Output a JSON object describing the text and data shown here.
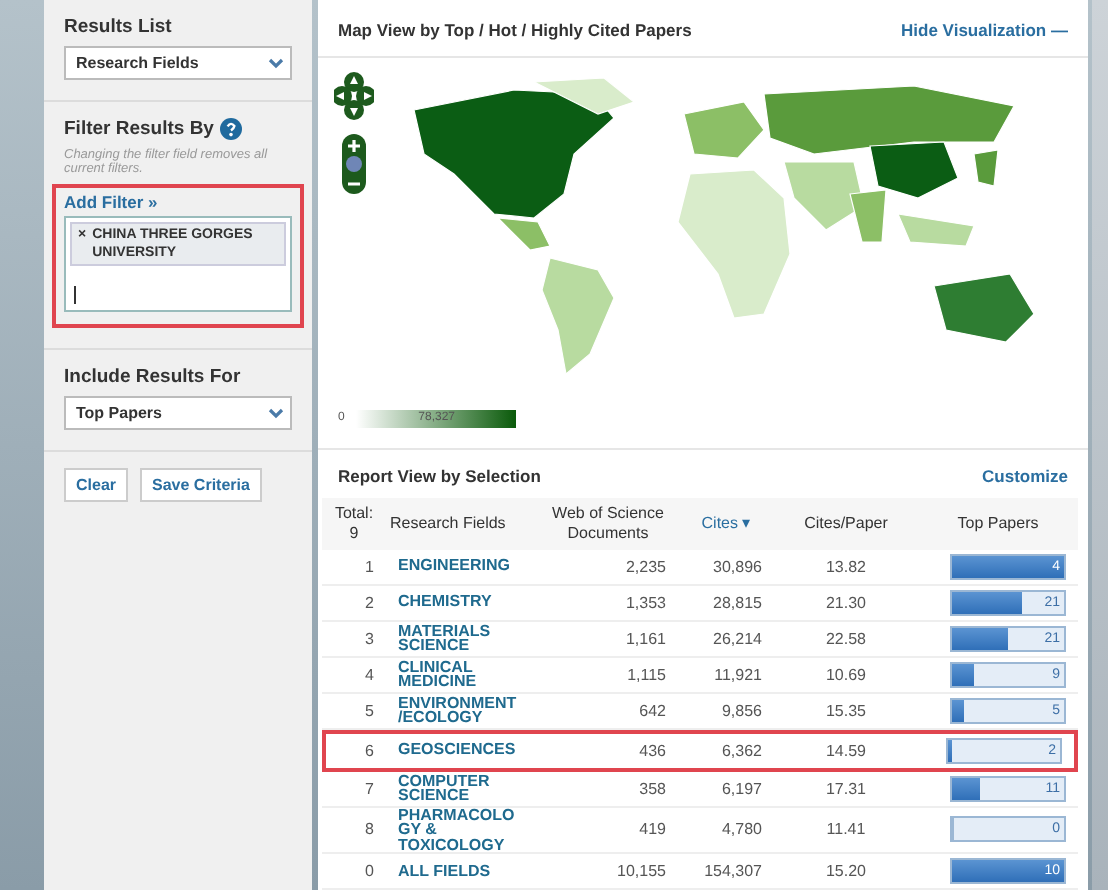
{
  "sidebar": {
    "results_list": {
      "label": "Results List",
      "value": "Research Fields"
    },
    "filter": {
      "label": "Filter Results By",
      "hint": "Changing the filter field removes all current filters.",
      "add_filter": "Add Filter »",
      "highlighted": true,
      "tags": [
        {
          "remove": "×",
          "text": "CHINA THREE GORGES UNIVERSITY"
        }
      ]
    },
    "include": {
      "label": "Include Results For",
      "value": "Top Papers"
    },
    "buttons": [
      "Clear",
      "Save Criteria"
    ]
  },
  "map_panel": {
    "title": "Map View by Top / Hot / Highly Cited Papers",
    "hide_link": "Hide Visualization",
    "hide_icon": "—",
    "legend": {
      "min": "0",
      "max": "78,327"
    }
  },
  "report": {
    "title": "Report View by Selection",
    "customize": "Customize",
    "columns": [
      {
        "label": "Total:\n9",
        "sorted": false
      },
      {
        "label": "Research Fields",
        "sorted": false
      },
      {
        "label": "Web of Science Documents",
        "sorted": false
      },
      {
        "label": "Cites ▾",
        "sorted": true
      },
      {
        "label": "Cites/Paper",
        "sorted": false
      },
      {
        "label": "Top Papers",
        "sorted": false
      }
    ],
    "rows": [
      {
        "rank": "1",
        "field": "ENGINEERING",
        "documents": "2,235",
        "cites": "30,896",
        "cites_per_paper": "13.82",
        "top_papers": "4",
        "level": 1.0,
        "highlighted": false
      },
      {
        "rank": "2",
        "field": "CHEMISTRY",
        "documents": "1,353",
        "cites": "28,815",
        "cites_per_paper": "21.30",
        "top_papers": "21",
        "level": 0.63,
        "highlighted": false
      },
      {
        "rank": "3",
        "field": "MATERIALS SCIENCE",
        "documents": "1,161",
        "cites": "26,214",
        "cites_per_paper": "22.58",
        "top_papers": "21",
        "level": 0.5,
        "highlighted": false
      },
      {
        "rank": "4",
        "field": "CLINICAL MEDICINE",
        "documents": "1,115",
        "cites": "11,921",
        "cites_per_paper": "10.69",
        "top_papers": "9",
        "level": 0.2,
        "highlighted": false
      },
      {
        "rank": "5",
        "field": "ENVIRONMENT/ECOLOGY",
        "documents": "642",
        "cites": "9,856",
        "cites_per_paper": "15.35",
        "top_papers": "5",
        "level": 0.1,
        "highlighted": false
      },
      {
        "rank": "6",
        "field": "GEOSCIENCES",
        "documents": "436",
        "cites": "6,362",
        "cites_per_paper": "14.59",
        "top_papers": "2",
        "level": 0.03,
        "highlighted": true
      },
      {
        "rank": "7",
        "field": "COMPUTER SCIENCE",
        "documents": "358",
        "cites": "6,197",
        "cites_per_paper": "17.31",
        "top_papers": "11",
        "level": 0.25,
        "highlighted": false
      },
      {
        "rank": "8",
        "field": "PHARMACOLOGY & TOXICOLOGY",
        "documents": "419",
        "cites": "4,780",
        "cites_per_paper": "11.41",
        "top_papers": "0",
        "level": 0,
        "highlighted": false
      },
      {
        "rank": "0",
        "field": "ALL FIELDS",
        "documents": "10,155",
        "cites": "154,307",
        "cites_per_paper": "15.20",
        "top_papers": "10",
        "level": 1.0,
        "highlighted": false
      }
    ]
  }
}
